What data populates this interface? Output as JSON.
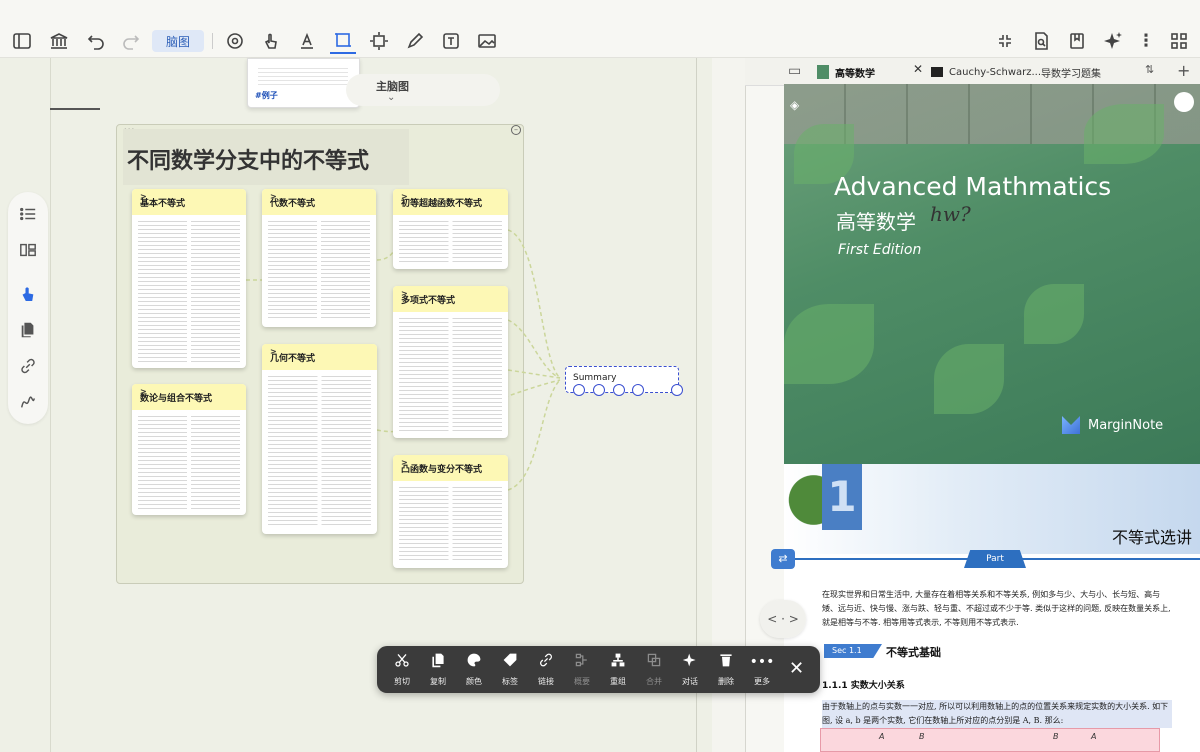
{
  "toolbar": {
    "mindmap_tab": "脑图"
  },
  "top_card": {
    "tag": "#例子"
  },
  "mindmap_pill": {
    "label": "主脑图"
  },
  "frame": {
    "title": "不同数学分支中的不等式"
  },
  "cards": [
    {
      "title": "基本不等式"
    },
    {
      "title": "代数不等式"
    },
    {
      "title": "初等超越函数不等式"
    },
    {
      "title": "多项式不等式"
    },
    {
      "title": "几何不等式"
    },
    {
      "title": "数论与组合不等式"
    },
    {
      "title": "凸函数与变分不等式"
    }
  ],
  "summary": {
    "label": "Summary"
  },
  "reader": {
    "tabs": [
      {
        "label": "高等数学",
        "active": true
      },
      {
        "label": "Cauchy-Schwarz...",
        "active": false
      },
      {
        "label": "导数学习题集",
        "active": false
      }
    ],
    "cover": {
      "title_en": "Advanced Mathmatics",
      "title_cn": "高等数学",
      "scribble": "hw?",
      "edition": "First Edition",
      "brand": "MarginNote"
    },
    "chapter": {
      "number": "1",
      "title": "不等式选讲",
      "part": "Part",
      "para1": "在现实世界和日常生活中, 大量存在着相等关系和不等关系, 例如多与少、大与小、长与短、高与矮、远与近、快与慢、涨与跌、轻与重、不超过或不少于等. 类似于这样的问题, 反映在数量关系上, 就是相等与不等. 相等用等式表示, 不等则用不等式表示.",
      "sec_tag": "Sec 1.1",
      "sec_title": "不等式基础",
      "sub_title": "1.1.1 实数大小关系",
      "para2": "由于数轴上的点与实数一一对应, 所以可以利用数轴上的点的位置关系来规定实数的大小关系. 如下图, 设 a, b 是两个实数, 它们在数轴上所对应的点分别是 A, B. 那么:",
      "axis_labels": [
        "A",
        "B",
        "B",
        "A"
      ]
    }
  },
  "actions": [
    {
      "label": "剪切",
      "icon": "scissors-icon"
    },
    {
      "label": "复制",
      "icon": "copy-icon"
    },
    {
      "label": "颜色",
      "icon": "palette-icon"
    },
    {
      "label": "标签",
      "icon": "tag-icon"
    },
    {
      "label": "链接",
      "icon": "link-icon"
    },
    {
      "label": "概要",
      "icon": "summary-icon"
    },
    {
      "label": "重组",
      "icon": "regroup-icon"
    },
    {
      "label": "合并",
      "icon": "merge-icon"
    },
    {
      "label": "对话",
      "icon": "ai-sparkle-icon"
    },
    {
      "label": "删除",
      "icon": "trash-icon"
    },
    {
      "label": "更多",
      "icon": "more-icon"
    }
  ],
  "colors": {
    "accent": "#2d6ae3",
    "card_head": "#fdf8b5",
    "summary_border": "#3a4fd0",
    "actionbar": "#3b3b3b"
  }
}
